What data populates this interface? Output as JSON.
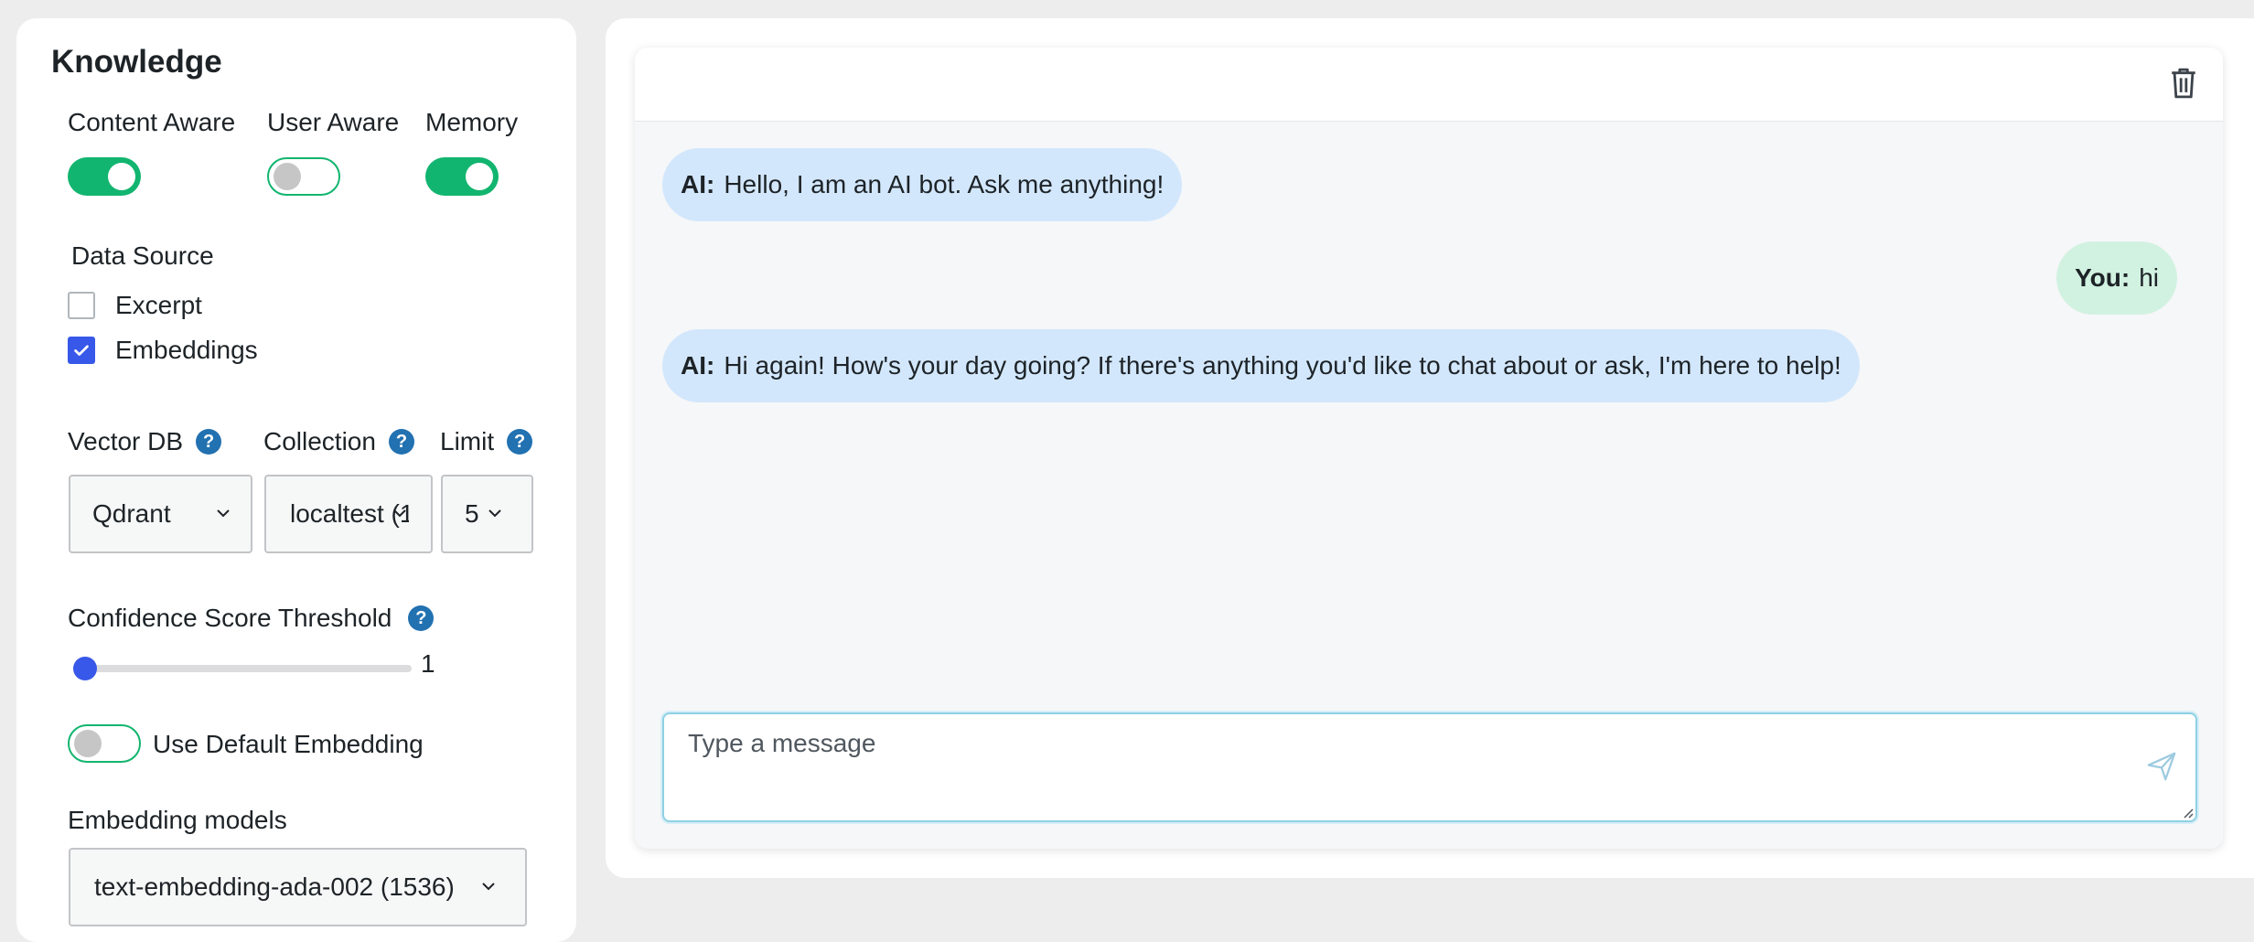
{
  "knowledge": {
    "title": "Knowledge",
    "toggles": [
      {
        "label": "Content Aware",
        "on": true
      },
      {
        "label": "User Aware",
        "on": false
      },
      {
        "label": "Memory",
        "on": true
      }
    ],
    "data_source": {
      "title": "Data Source",
      "options": [
        {
          "label": "Excerpt",
          "checked": false
        },
        {
          "label": "Embeddings",
          "checked": true
        }
      ]
    },
    "vector_db": {
      "label": "Vector DB",
      "value": "Qdrant"
    },
    "collection": {
      "label": "Collection",
      "value": "localtest (1"
    },
    "limit": {
      "label": "Limit",
      "value": "5"
    },
    "help_glyph": "?",
    "confidence": {
      "label": "Confidence Score Threshold",
      "value": "1",
      "fraction": 0.0
    },
    "default_embedding": {
      "label": "Use Default Embedding",
      "on": false
    },
    "embedding_models": {
      "label": "Embedding models",
      "value": "text-embedding-ada-002 (1536)"
    }
  },
  "chat": {
    "messages": [
      {
        "role": "AI:",
        "text": "Hello, I am an AI bot. Ask me anything!"
      },
      {
        "role": "You:",
        "text": "hi"
      },
      {
        "role": "AI:",
        "text": "Hi again! How's your day going? If there's anything you'd like to chat about or ask, I'm here to help!"
      }
    ],
    "input_placeholder": "Type a message"
  },
  "colors": {
    "accent_green": "#12b56f",
    "checkbox_blue": "#3858e9",
    "help_blue": "#2271b1",
    "ai_bubble": "#d3e7fc",
    "user_bubble": "#d2f2e1"
  },
  "icons": [
    "help-icon",
    "chevron-down-icon",
    "trash-icon",
    "send-icon",
    "checkmark-icon"
  ]
}
